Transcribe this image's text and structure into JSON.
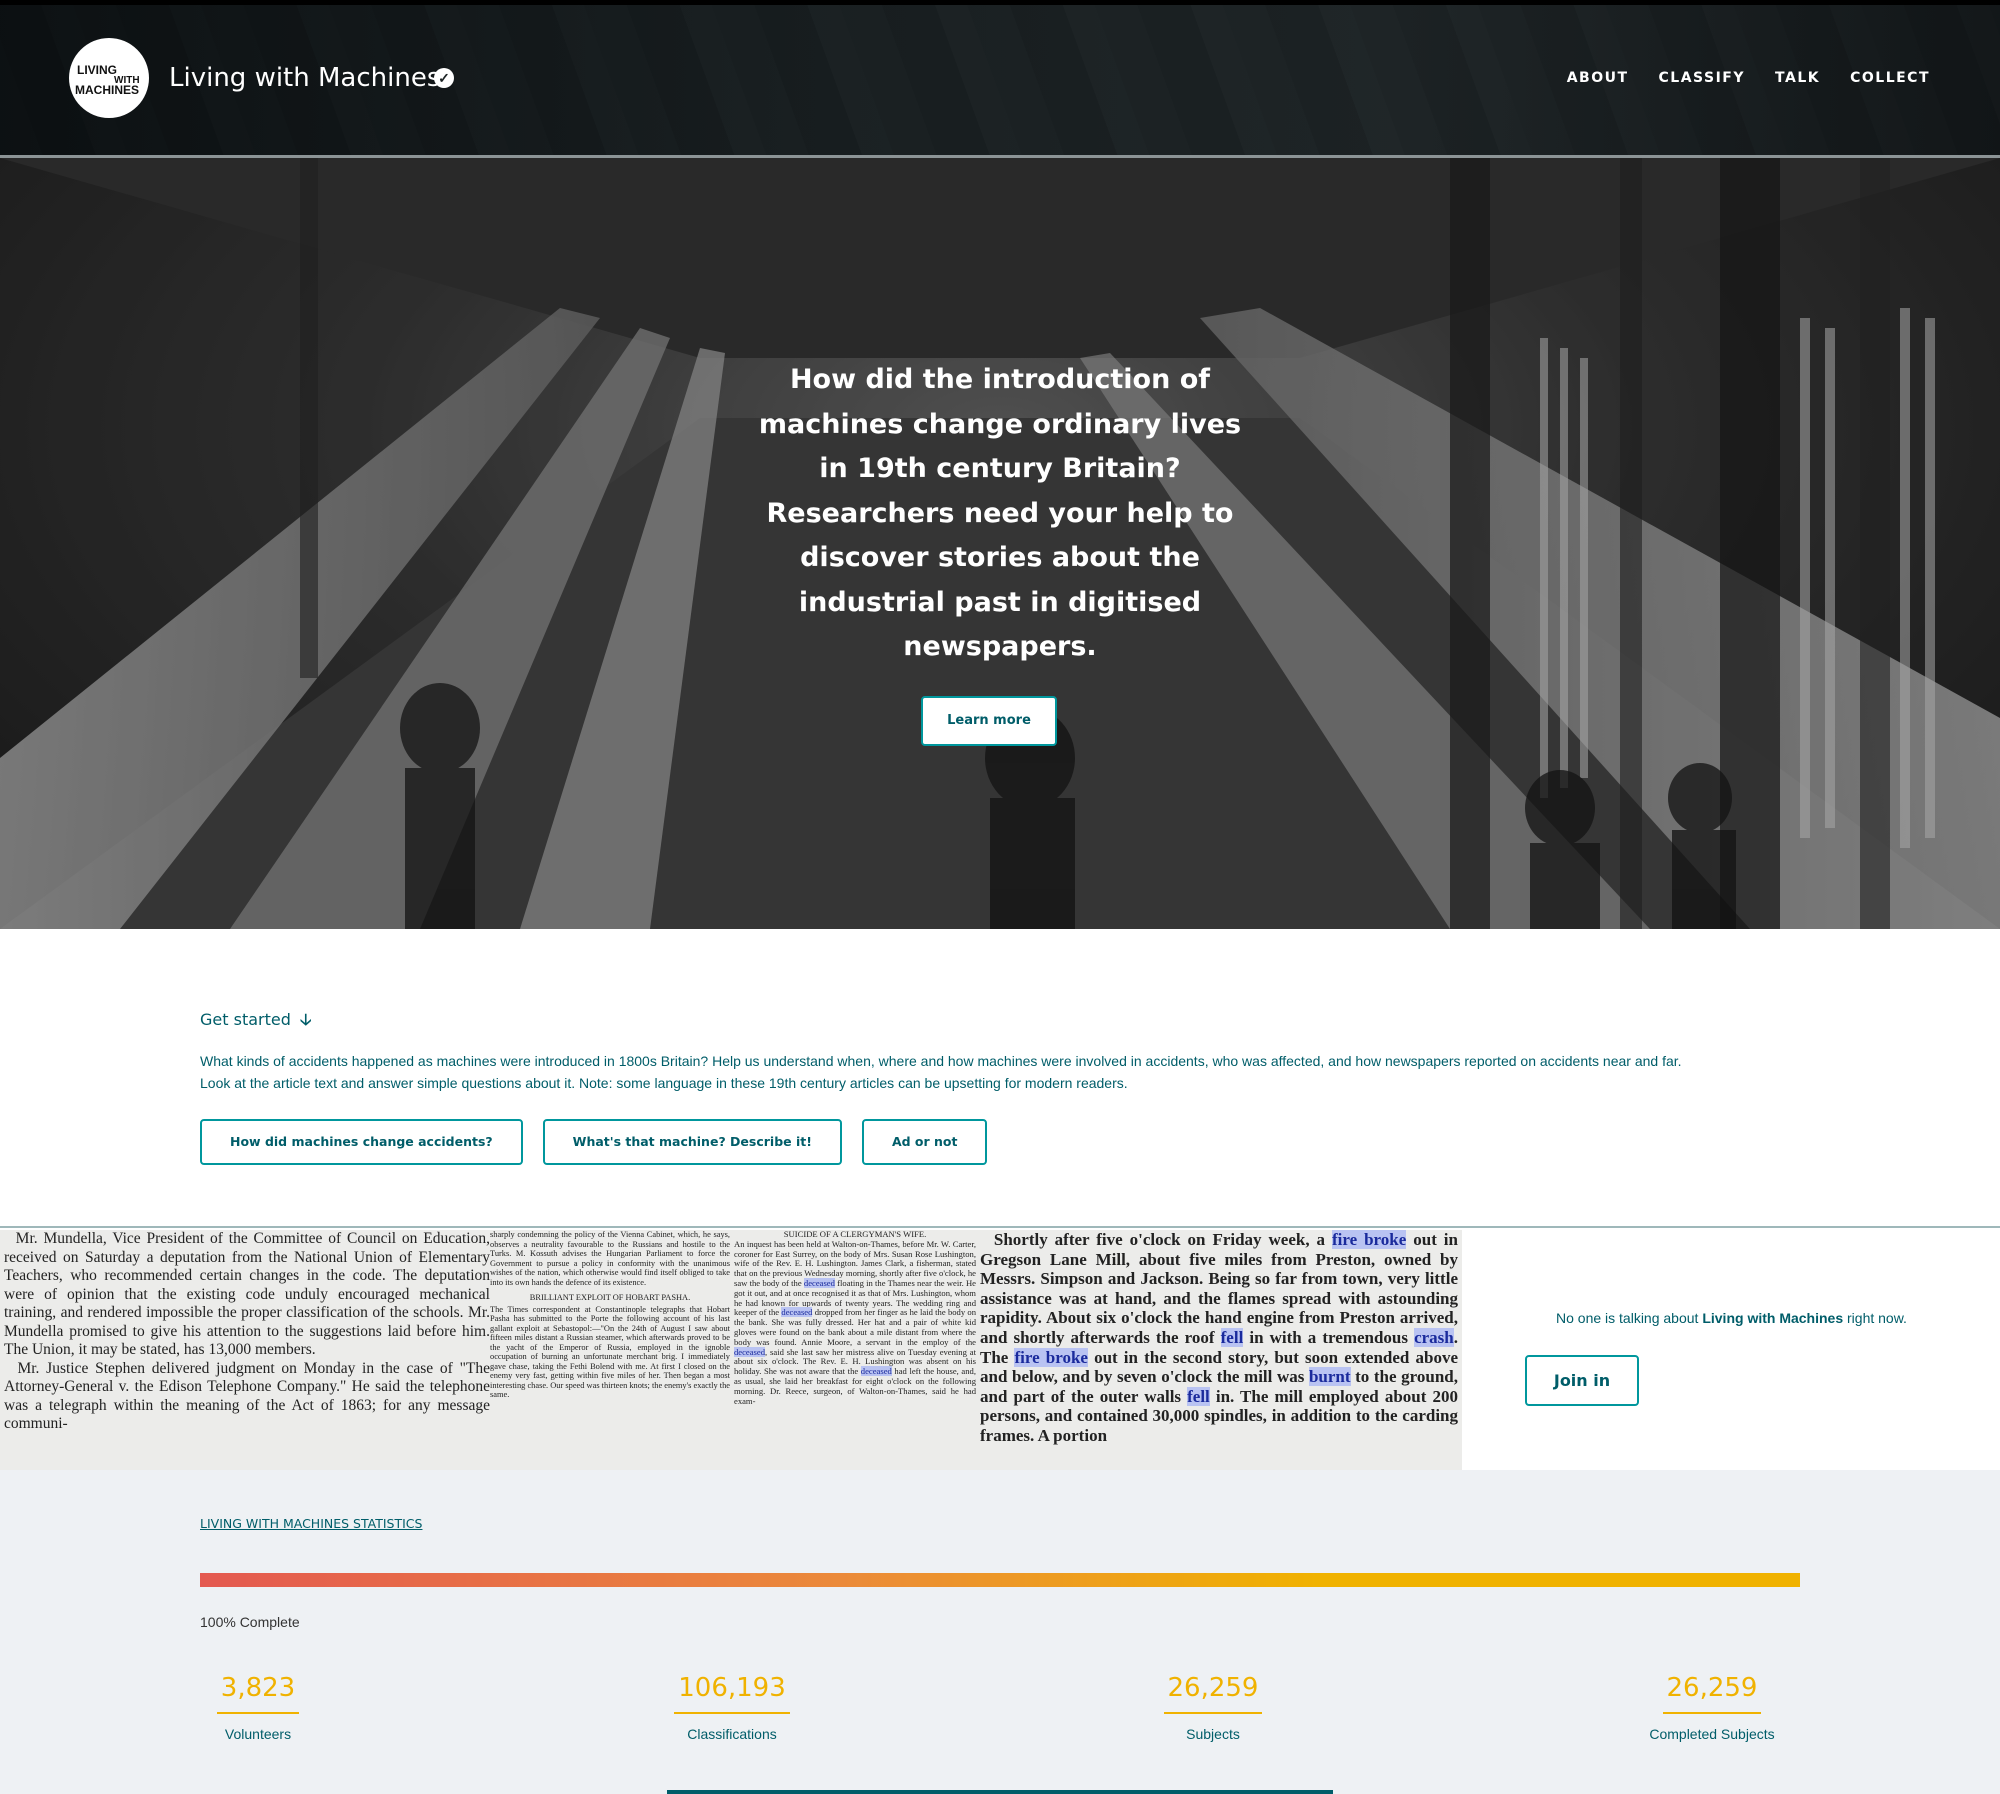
{
  "header": {
    "logo_text": [
      "LIVING",
      "WITH",
      "MACHINES"
    ],
    "title": "Living with Machines",
    "verified_icon": "✓",
    "nav": [
      "ABOUT",
      "CLASSIFY",
      "TALK",
      "COLLECT"
    ]
  },
  "hero": {
    "headline": "How did the introduction of machines change ordinary lives in 19th century Britain? Researchers need your help to discover stories about the industrial past in digitised newspapers.",
    "button": "Learn more"
  },
  "get_started": {
    "title": "Get started",
    "arrow_icon": "🡣",
    "description_line1": "What kinds of accidents happened as machines were introduced in 1800s Britain? Help us understand when, where and how machines were involved in accidents, who was affected, and how newspapers reported on accidents near and far.",
    "description_line2": "Look at the article text and answer simple questions about it. Note: some language in these 19th century articles can be upsetting for modern readers.",
    "workflows": [
      "How did machines change accidents?",
      "What's that machine? Describe it!",
      "Ad or not"
    ]
  },
  "talk": {
    "message_prefix": "No one is talking about ",
    "message_project": "Living with Machines",
    "message_suffix": " right now.",
    "button": "Join in"
  },
  "statistics": {
    "heading": "LIVING WITH MACHINES STATISTICS",
    "progress_fraction": 1.0,
    "complete_label": "100% Complete",
    "items": [
      {
        "value": "3,823",
        "label": "Volunteers"
      },
      {
        "value": "106,193",
        "label": "Classifications"
      },
      {
        "value": "26,259",
        "label": "Subjects"
      },
      {
        "value": "26,259",
        "label": "Completed Subjects"
      }
    ]
  },
  "colors": {
    "teal": "#005d69",
    "teal_border": "#00979d",
    "gold": "#f0b200",
    "stats_bg": "#eef1f4"
  }
}
